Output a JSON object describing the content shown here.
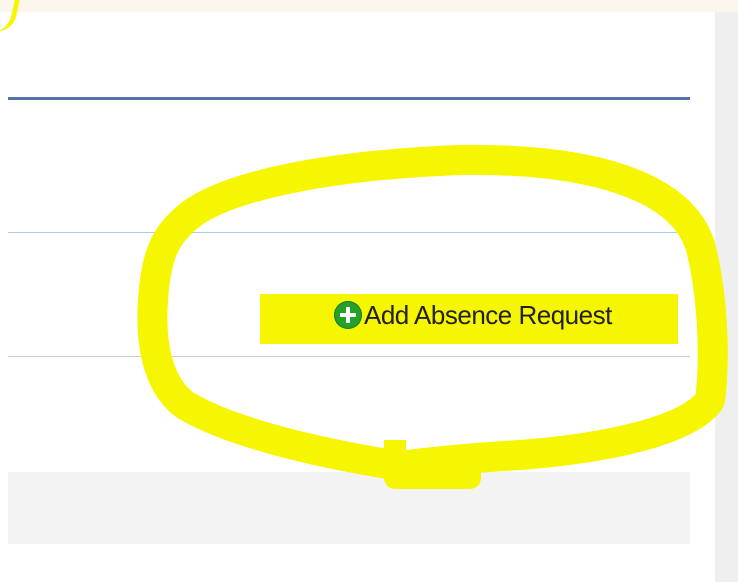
{
  "absence_panel": {
    "add_request_label": "Add Absence Request",
    "add_request_icon": "plus-circle-icon"
  },
  "colors": {
    "header_rule": "#5571ac",
    "highlight": "#f6f600",
    "add_icon": "#27a02b"
  }
}
